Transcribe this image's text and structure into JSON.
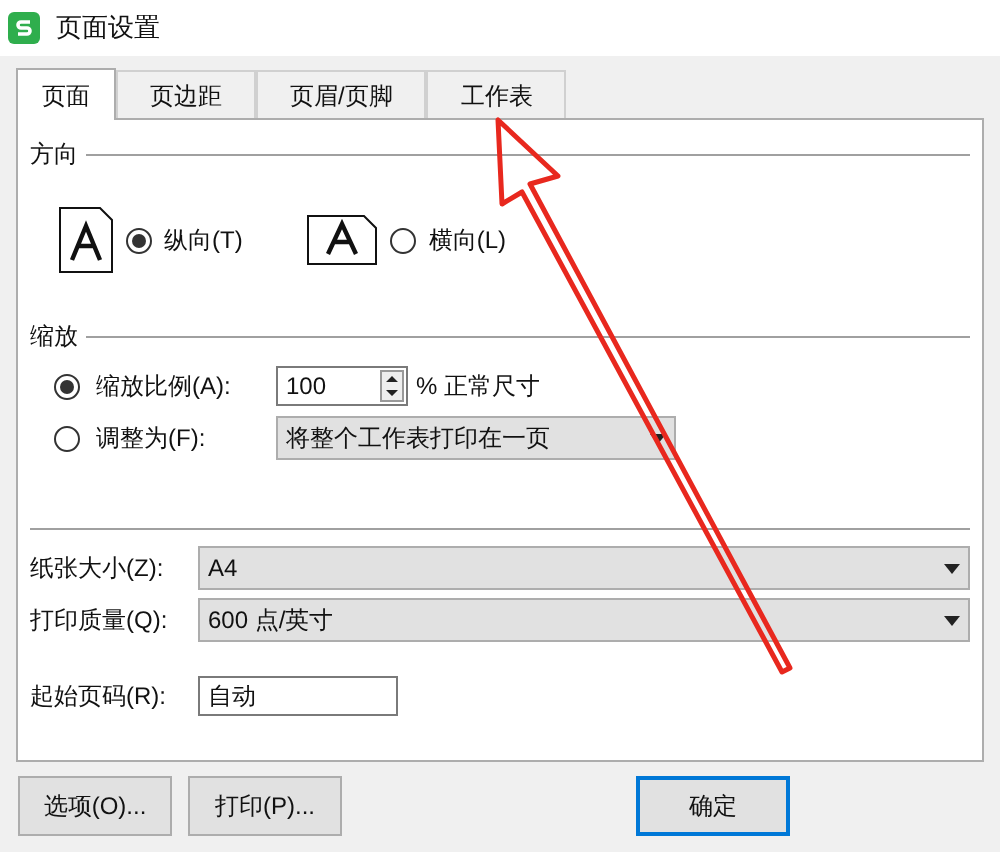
{
  "window": {
    "title": "页面设置"
  },
  "tabs": [
    {
      "label": "页面",
      "selected": true
    },
    {
      "label": "页边距",
      "selected": false
    },
    {
      "label": "页眉/页脚",
      "selected": false
    },
    {
      "label": "工作表",
      "selected": false
    }
  ],
  "orientation": {
    "title": "方向",
    "options": [
      {
        "label": "纵向(T)",
        "selected": true
      },
      {
        "label": "横向(L)",
        "selected": false
      }
    ]
  },
  "scaling": {
    "title": "缩放",
    "options": [
      {
        "kind": "percent",
        "label": "缩放比例(A):",
        "selected": true,
        "value": "100",
        "suffix": "% 正常尺寸"
      },
      {
        "kind": "fit",
        "label": "调整为(F):",
        "selected": false,
        "value": "将整个工作表打印在一页"
      }
    ]
  },
  "fields": [
    {
      "kind": "select",
      "label": "纸张大小(Z):",
      "value": "A4"
    },
    {
      "kind": "select",
      "label": "打印质量(Q):",
      "value": "600 点/英寸"
    },
    {
      "kind": "input",
      "label": "起始页码(R):",
      "value": "自动"
    }
  ],
  "buttons": [
    {
      "label": "选项(O)...",
      "primary": false
    },
    {
      "label": "打印(P)...",
      "primary": false
    },
    {
      "label": "确定",
      "primary": true
    }
  ]
}
